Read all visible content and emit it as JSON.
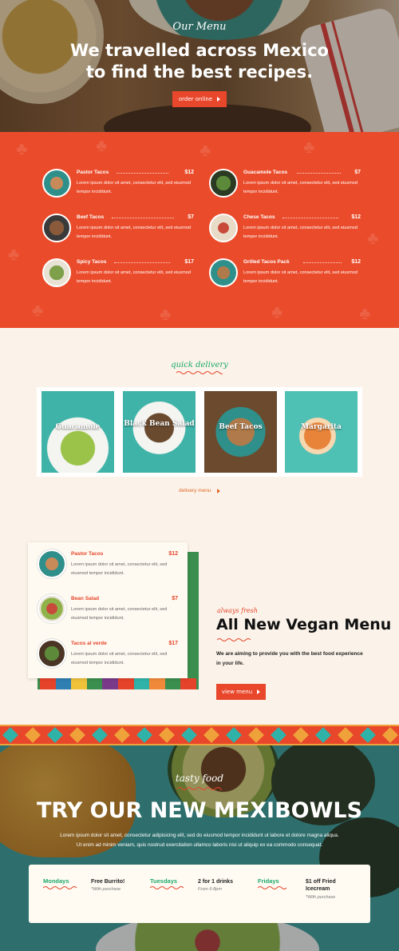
{
  "hero": {
    "subtitle": "Our Menu",
    "title_line1": "We travelled across Mexico",
    "title_line2": "to find the best recipes.",
    "button": "order online"
  },
  "menu": {
    "items": [
      {
        "name": "Pastor Tacos",
        "price": "$12",
        "desc": "Lorem ipsum dolor sit amet, consectetur elit, sed eiusmod tempor incididunt."
      },
      {
        "name": "Guacamole Tacos",
        "price": "$7",
        "desc": "Lorem ipsum dolor sit amet, consectetur elit, sed eiusmod tempor incididunt."
      },
      {
        "name": "Beef Tacos",
        "price": "$7",
        "desc": "Lorem ipsum dolor sit amet, consectetur elit, sed eiusmod tempor incididunt."
      },
      {
        "name": "Chese Tacos",
        "price": "$12",
        "desc": "Lorem ipsum dolor sit amet, consectetur elit, sed eiusmod tempor incididunt."
      },
      {
        "name": "Spicy Tacos",
        "price": "$17",
        "desc": "Lorem ipsum dolor sit amet, consectetur elit, sed eiusmod tempor incididunt."
      },
      {
        "name": "Grilled Tacos Pack",
        "price": "$12",
        "desc": "Lorem ipsum dolor sit amet, consectetur elit, sed eiusmod tempor incididunt."
      }
    ]
  },
  "delivery": {
    "title": "quick delivery",
    "cards": [
      {
        "label": "Guacamole"
      },
      {
        "label": "Black Bean Salad"
      },
      {
        "label": "Beef Tacos"
      },
      {
        "label": "Margarita"
      }
    ],
    "link": "delivery menu"
  },
  "vegan": {
    "items": [
      {
        "name": "Pastor Tacos",
        "price": "$12",
        "desc": "Lorem ipsum dolor sit amet, consectetur elit, sed eiusmod tempor incididunt."
      },
      {
        "name": "Bean Salad",
        "price": "$7",
        "desc": "Lorem ipsum dolor sit amet, consectetur elit, sed eiusmod tempor incididunt."
      },
      {
        "name": "Tacos al verde",
        "price": "$17",
        "desc": "Lorem ipsum dolor sit amet, consectetur elit, sed eiusmod tempor incididunt."
      }
    ],
    "tag": "always fresh",
    "heading": "All New Vegan Menu",
    "text": "We are aiming to provide you with the best food experience in your life.",
    "button": "view menu"
  },
  "bowls": {
    "tag": "tasty food",
    "heading": "TRY OUR NEW MEXIBOWLS",
    "paragraph": "Lorem ipsum dolor sit amet, consectetur adipisicing elit, sed do eiusmod tempor incididunt ut labore et dolore magna aliqua. Ut enim ad minim veniam, quis nostrud exercitation ullamco laboris nisi ut aliquip ex ea commodo consequat.",
    "deals": [
      {
        "day": "Mondays",
        "offer": "Free Burrito!",
        "note": "*With purchase"
      },
      {
        "day": "Tuesdays",
        "offer": "2 for 1 drinks",
        "note": "From 6-8pm"
      },
      {
        "day": "Fridays",
        "offer": "$1 off Fried Icecream",
        "note": "*With purchase"
      }
    ]
  },
  "colors": {
    "brand_red": "#ea4b2a",
    "accent_green": "#1ea86b",
    "cream": "#fbf3e9"
  }
}
